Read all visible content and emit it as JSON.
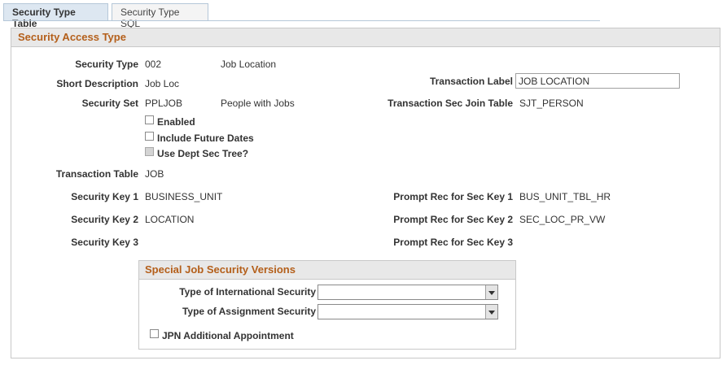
{
  "tabs": [
    {
      "label": "Security Type Table",
      "active": true
    },
    {
      "label": "Security Type SQL",
      "active": false
    }
  ],
  "security_access": {
    "title": "Security Access Type",
    "security_type": {
      "label": "Security Type",
      "code": "002",
      "description": "Job Location"
    },
    "short_description": {
      "label": "Short Description",
      "value": "Job Loc"
    },
    "transaction_label": {
      "label": "Transaction Label",
      "value": "JOB LOCATION"
    },
    "security_set": {
      "label": "Security Set",
      "code": "PPLJOB",
      "description": "People with Jobs"
    },
    "transaction_sec_join_table": {
      "label": "Transaction Sec Join Table",
      "value": "SJT_PERSON"
    },
    "checkboxes": [
      {
        "label": "Enabled",
        "checked": false,
        "disabled": false
      },
      {
        "label": "Include Future Dates",
        "checked": false,
        "disabled": false
      },
      {
        "label": "Use Dept Sec Tree?",
        "checked": false,
        "disabled": true
      }
    ],
    "transaction_table": {
      "label": "Transaction Table",
      "value": "JOB"
    },
    "security_keys": [
      {
        "label": "Security Key 1",
        "value": "BUSINESS_UNIT",
        "prompt_label": "Prompt Rec for Sec Key 1",
        "prompt_value": "BUS_UNIT_TBL_HR"
      },
      {
        "label": "Security Key 2",
        "value": "LOCATION",
        "prompt_label": "Prompt Rec for Sec Key 2",
        "prompt_value": "SEC_LOC_PR_VW"
      },
      {
        "label": "Security Key 3",
        "value": "",
        "prompt_label": "Prompt Rec for Sec Key 3",
        "prompt_value": ""
      }
    ]
  },
  "special_job_security": {
    "title": "Special Job Security Versions",
    "international_security": {
      "label": "Type of International Security",
      "value": ""
    },
    "assignment_security": {
      "label": "Type of Assignment Security",
      "value": ""
    },
    "jpn_additional": {
      "label": "JPN Additional Appointment",
      "checked": false
    }
  }
}
